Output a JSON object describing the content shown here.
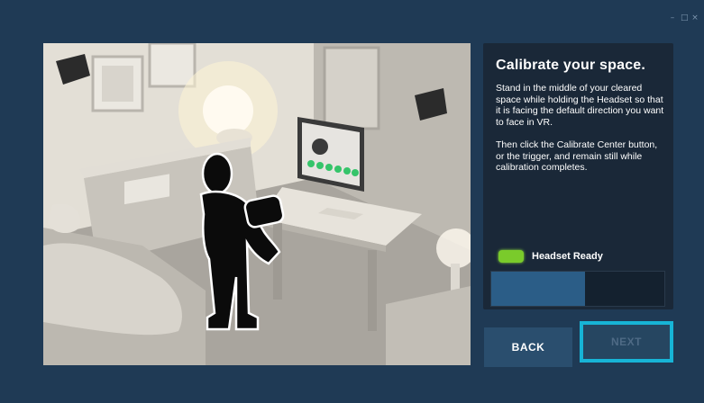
{
  "window": {
    "minimize_glyph": "–",
    "maximize_glyph": "□",
    "close_glyph": "×"
  },
  "illustration": {
    "subject": "room-calibration-scene"
  },
  "panel": {
    "title": "Calibrate your space.",
    "paragraph_1": "Stand in the middle of your cleared space while holding the Headset so that it is facing the default direction you want to face in VR.",
    "paragraph_2": "Then click the Calibrate Center button, or the trigger, and remain still while calibration completes."
  },
  "status": {
    "label": "Headset Ready",
    "color": "#7acb2b"
  },
  "progress": {
    "fraction": 0.54
  },
  "buttons": {
    "back_label": "BACK",
    "next_label": "NEXT"
  },
  "colors": {
    "background": "#1f3a55",
    "panel": "#1a2838",
    "accent_focus": "#17b4d6",
    "progress_fill": "#2b5d87"
  }
}
